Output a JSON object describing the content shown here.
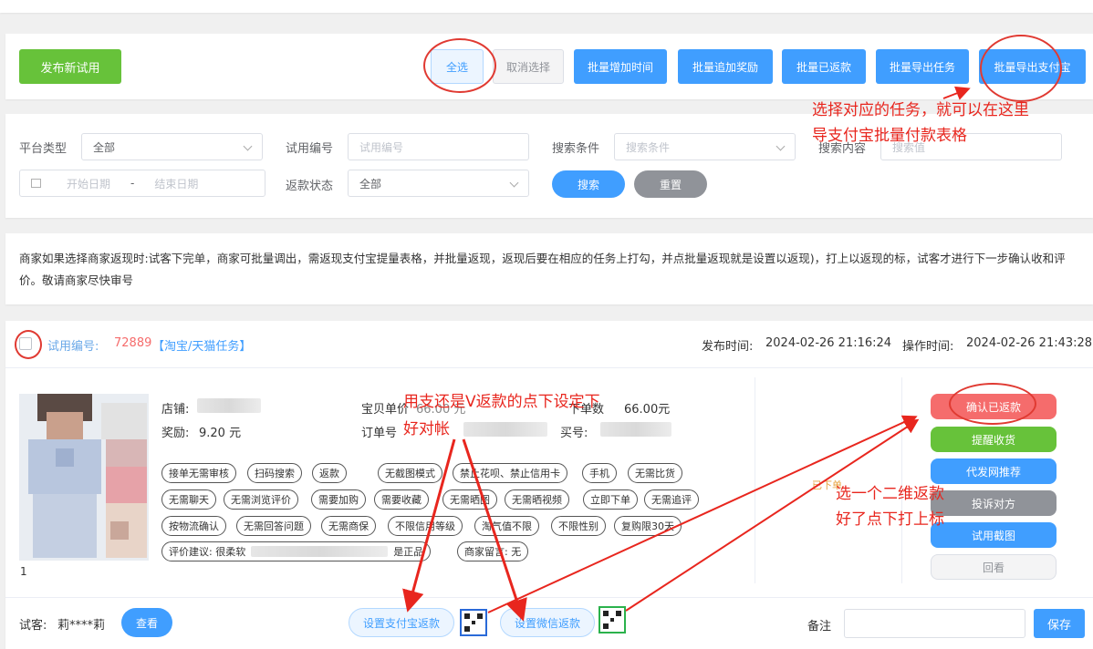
{
  "toolbar": {
    "publish_label": "发布新试用",
    "select_all_label": "全选",
    "deselect_label": "取消选择",
    "batch_add_time": "批量增加时间",
    "batch_add_reward": "批量追加奖励",
    "batch_refunded": "批量已返款",
    "batch_export_task": "批量导出任务",
    "batch_export_alipay": "批量导出支付宝"
  },
  "filters": {
    "platform_label": "平台类型",
    "platform_value": "全部",
    "trial_no_label": "试用编号",
    "trial_no_placeholder": "试用编号",
    "search_cond_label": "搜索条件",
    "search_cond_placeholder": "搜索条件",
    "search_content_label": "搜索内容",
    "search_content_placeholder": "搜索值",
    "start_date_placeholder": "开始日期",
    "date_sep": "-",
    "end_date_placeholder": "结束日期",
    "refund_status_label": "返款状态",
    "refund_status_value": "全部",
    "search_btn": "搜索",
    "reset_btn": "重置"
  },
  "notice": {
    "text": "商家如果选择商家返现时:试客下完单，商家可批量调出，需返现支付宝提量表格，并批量返现，返现后要在相应的任务上打勾，并点批量返现就是设置以返现)，打上以返现的标，试客才进行下一步确认收和评价。敬请商家尽快审号"
  },
  "task": {
    "trial_no_label": "试用编号:",
    "trial_no": "72889",
    "platform_tag": "【淘宝/天猫任务】",
    "publish_time_label": "发布时间:",
    "publish_time": "2024-02-26 21:16:24",
    "op_time_label": "操作时间:",
    "op_time": "2024-02-26 21:43:28",
    "shop_label": "店铺:",
    "reward_label": "奖励:",
    "reward_value": "9.20 元",
    "unit_price_label": "宝贝单价",
    "unit_price_value": "66.00 元",
    "order_amount_label": "下单数",
    "order_amount_value": "66.00元",
    "order_no_label": "订单号",
    "buyer_no_label": "买号:",
    "image_index": "1",
    "tags": [
      "接单无需审核",
      "扫码搜索",
      "返款",
      "无截图模式",
      "禁止花呗、禁止信用卡",
      "手机",
      "无需比货",
      "无需聊天",
      "无需浏览评价",
      "需要加购",
      "需要收藏",
      "无需晒图",
      "无需晒视频",
      "立即下单",
      "无需追评",
      "按物流确认",
      "无需回答问题",
      "无需商保",
      "不限信用等级",
      "淘气值不限",
      "不限性别",
      "复购限30天"
    ],
    "review_label": "评价建议: 很柔软",
    "review_end": "是正品",
    "merchant_note": "商家留言: 无",
    "status_text": "已下单",
    "actions": {
      "confirm_refunded": "确认已返款",
      "remind_receive": "提醒收货",
      "proxy_recommend": "代发网推荐",
      "complain": "投诉对方",
      "trial_screenshot": "试用截图",
      "review": "回看"
    },
    "tester_label": "试客:",
    "tester_name": "莉****莉",
    "view_btn": "查看",
    "set_alipay_refund": "设置支付宝返款",
    "set_wechat_refund": "设置微信返款",
    "remark_label": "备注",
    "save_btn": "保存"
  },
  "annotations": {
    "a1_line1": "选择对应的任务，就可以在这里",
    "a1_line2": "导支付宝批量付款表格",
    "a2_line1": "用支还是V返款的点下设定下",
    "a2_line2": "好对帐",
    "a3_line1": "选一个二维返款",
    "a3_line2": "好了点下打上标"
  }
}
